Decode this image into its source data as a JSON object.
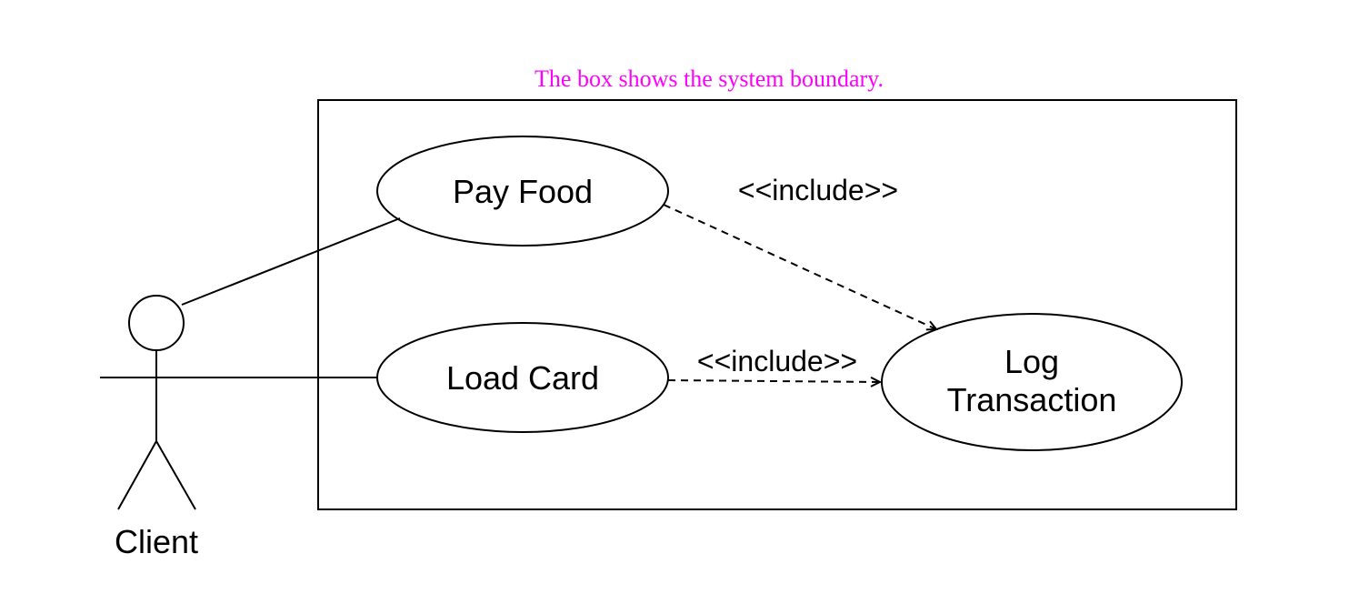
{
  "diagram": {
    "caption": "The box shows the system boundary.",
    "actor": {
      "name": "Client"
    },
    "usecases": {
      "pay_food": "Pay Food",
      "load_card": "Load Card",
      "log_transaction_line1": "Log",
      "log_transaction_line2": "Transaction"
    },
    "relations": {
      "include1": "<<include>>",
      "include2": "<<include>>"
    }
  }
}
